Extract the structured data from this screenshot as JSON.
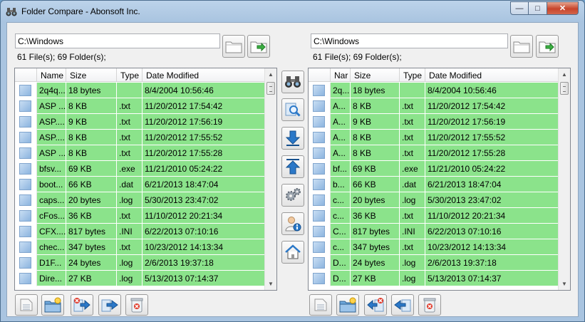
{
  "window": {
    "title": "Folder Compare - Abonsoft Inc."
  },
  "left": {
    "path": "C:\\Windows",
    "counts": "61 File(s); 69 Folder(s);",
    "columns": [
      "Name",
      "Size",
      "Type",
      "Date Modified"
    ],
    "rows": [
      {
        "name": "2q4q...",
        "size": "18 bytes",
        "type": "",
        "date": "8/4/2004 10:56:46"
      },
      {
        "name": "ASP ...",
        "size": "8 KB",
        "type": ".txt",
        "date": "11/20/2012 17:54:42"
      },
      {
        "name": "ASP....",
        "size": "9 KB",
        "type": ".txt",
        "date": "11/20/2012 17:56:19"
      },
      {
        "name": "ASP....",
        "size": "8 KB",
        "type": ".txt",
        "date": "11/20/2012 17:55:52"
      },
      {
        "name": "ASP ...",
        "size": "8 KB",
        "type": ".txt",
        "date": "11/20/2012 17:55:28"
      },
      {
        "name": "bfsv...",
        "size": "69 KB",
        "type": ".exe",
        "date": "11/21/2010 05:24:22"
      },
      {
        "name": "boot...",
        "size": "66 KB",
        "type": ".dat",
        "date": "6/21/2013 18:47:04"
      },
      {
        "name": "caps...",
        "size": "20 bytes",
        "type": ".log",
        "date": "5/30/2013 23:47:02"
      },
      {
        "name": "cFos...",
        "size": "36 KB",
        "type": ".txt",
        "date": "11/10/2012 20:21:34"
      },
      {
        "name": "CFX....",
        "size": "817 bytes",
        "type": ".INI",
        "date": "6/22/2013 07:10:16"
      },
      {
        "name": "chec...",
        "size": "347 bytes",
        "type": ".txt",
        "date": "10/23/2012 14:13:34"
      },
      {
        "name": "D1F...",
        "size": "24 bytes",
        "type": ".log",
        "date": "2/6/2013 19:37:18"
      },
      {
        "name": "Dire...",
        "size": "27 KB",
        "type": ".log",
        "date": "5/13/2013 07:14:37"
      }
    ]
  },
  "right": {
    "path": "C:\\Windows",
    "counts": "61 File(s); 69 Folder(s);",
    "columns": [
      "Nar",
      "Size",
      "Type",
      "Date Modified"
    ],
    "rows": [
      {
        "name": "2q...",
        "size": "18 bytes",
        "type": "",
        "date": "8/4/2004 10:56:46"
      },
      {
        "name": "A...",
        "size": "8 KB",
        "type": ".txt",
        "date": "11/20/2012 17:54:42"
      },
      {
        "name": "A...",
        "size": "9 KB",
        "type": ".txt",
        "date": "11/20/2012 17:56:19"
      },
      {
        "name": "A...",
        "size": "8 KB",
        "type": ".txt",
        "date": "11/20/2012 17:55:52"
      },
      {
        "name": "A...",
        "size": "8 KB",
        "type": ".txt",
        "date": "11/20/2012 17:55:28"
      },
      {
        "name": "bf...",
        "size": "69 KB",
        "type": ".exe",
        "date": "11/21/2010 05:24:22"
      },
      {
        "name": "b...",
        "size": "66 KB",
        "type": ".dat",
        "date": "6/21/2013 18:47:04"
      },
      {
        "name": "c...",
        "size": "20 bytes",
        "type": ".log",
        "date": "5/30/2013 23:47:02"
      },
      {
        "name": "c...",
        "size": "36 KB",
        "type": ".txt",
        "date": "11/10/2012 20:21:34"
      },
      {
        "name": "C...",
        "size": "817 bytes",
        "type": ".INI",
        "date": "6/22/2013 07:10:16"
      },
      {
        "name": "c...",
        "size": "347 bytes",
        "type": ".txt",
        "date": "10/23/2012 14:13:34"
      },
      {
        "name": "D...",
        "size": "24 bytes",
        "type": ".log",
        "date": "2/6/2013 19:37:18"
      },
      {
        "name": "D...",
        "size": "27 KB",
        "type": ".log",
        "date": "5/13/2013 07:14:37"
      }
    ]
  },
  "colors": {
    "match_row": "#8be38b",
    "accent_blue": "#2b78c8"
  }
}
